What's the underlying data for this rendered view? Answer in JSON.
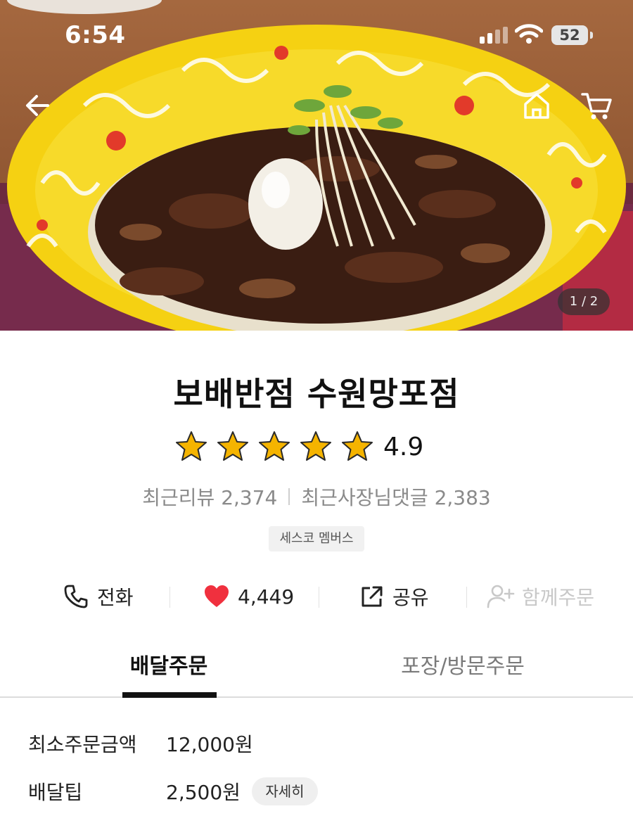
{
  "status_bar": {
    "time": "6:54",
    "battery": "52"
  },
  "hero": {
    "page_indicator": "1 / 2"
  },
  "store": {
    "name": "보배반점 수원망포점",
    "rating": 4.9,
    "rating_text": "4.9",
    "recent_reviews": "최근리뷰 2,374",
    "owner_replies": "최근사장님댓글 2,383",
    "badge": "세스코 멤버스"
  },
  "actions": {
    "call_label": "전화",
    "like_count": "4,449",
    "share_label": "공유",
    "group_order_label": "함께주문"
  },
  "tabs": {
    "delivery": "배달주문",
    "pickup": "포장/방문주문"
  },
  "delivery_info": {
    "min_order_label": "최소주문금액",
    "min_order_value": "12,000원",
    "tip_label": "배달팁",
    "tip_value": "2,500원",
    "detail_button": "자세히"
  },
  "colors": {
    "star": "#f5b400",
    "heart": "#f0303e",
    "bowl": "#f5d112",
    "sauce": "#3a1d12"
  },
  "icons": [
    "back-arrow-icon",
    "home-icon",
    "cart-icon",
    "phone-icon",
    "heart-icon",
    "share-icon",
    "add-user-icon",
    "star-icon"
  ]
}
